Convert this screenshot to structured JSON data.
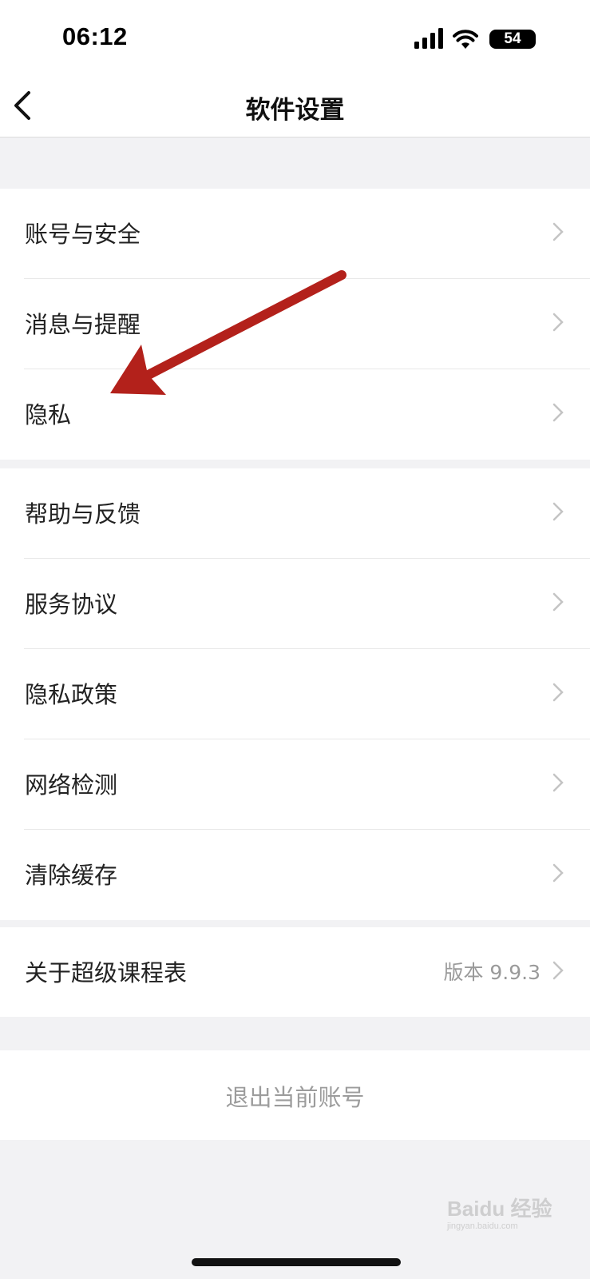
{
  "status_bar": {
    "time": "06:12",
    "battery": "54"
  },
  "nav": {
    "title": "软件设置",
    "back_icon": "chevron-left-icon"
  },
  "group1": [
    {
      "label": "账号与安全"
    },
    {
      "label": "消息与提醒"
    },
    {
      "label": "隐私"
    }
  ],
  "group2": [
    {
      "label": "帮助与反馈"
    },
    {
      "label": "服务协议"
    },
    {
      "label": "隐私政策"
    },
    {
      "label": "网络检测"
    },
    {
      "label": "清除缓存"
    }
  ],
  "group3": [
    {
      "label": "关于超级课程表",
      "value": "版本 9.9.3"
    }
  ],
  "logout": {
    "label": "退出当前账号"
  },
  "watermark": {
    "text": "Baidu 经验",
    "subtext": "jingyan.baidu.com"
  },
  "colors": {
    "annotation_arrow": "#b3211b",
    "chevron": "#c4c4c4",
    "page_bg": "#f2f2f4"
  }
}
